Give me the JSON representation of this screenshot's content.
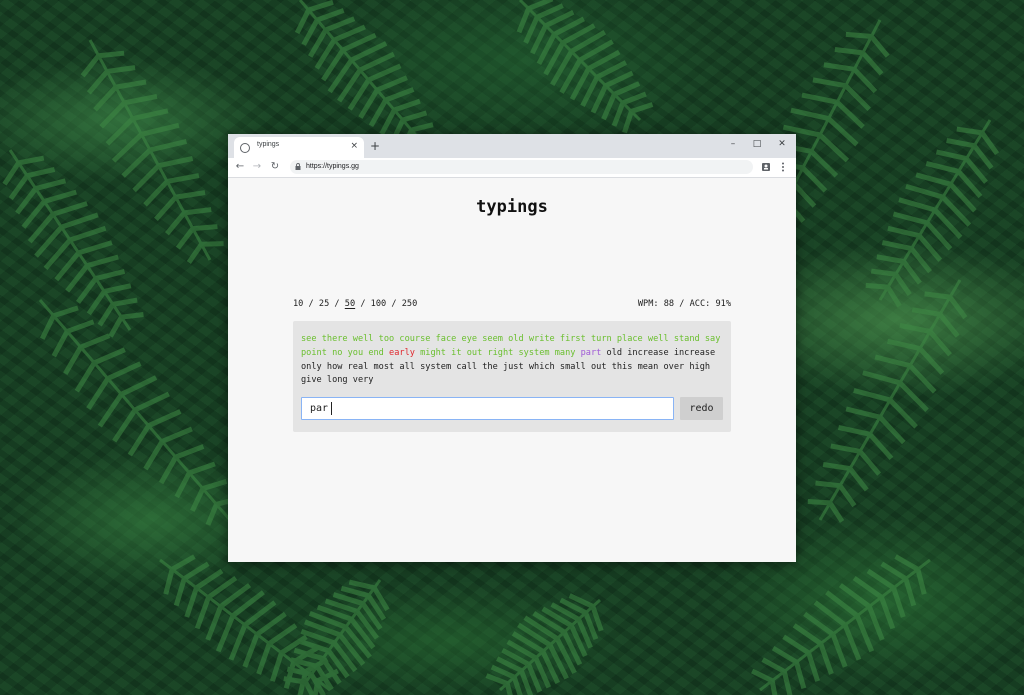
{
  "browser": {
    "tab_title": "typings",
    "tab_close": "×",
    "new_tab": "+",
    "window_controls": {
      "minimize": "–",
      "maximize": "□",
      "close": "✕"
    },
    "nav": {
      "back": "←",
      "forward": "→",
      "reload": "↻"
    },
    "url": "https://typings.gg"
  },
  "app": {
    "title": "typings",
    "word_count_options": [
      "10",
      "25",
      "50",
      "100",
      "250"
    ],
    "selected_word_count": "50",
    "separator": "/",
    "stats": "WPM: 88 / ACC: 91%",
    "prompt_words": [
      {
        "w": "see",
        "s": "correct"
      },
      {
        "w": "there",
        "s": "correct"
      },
      {
        "w": "well",
        "s": "correct"
      },
      {
        "w": "too",
        "s": "correct"
      },
      {
        "w": "course",
        "s": "correct"
      },
      {
        "w": "face",
        "s": "correct"
      },
      {
        "w": "eye",
        "s": "correct"
      },
      {
        "w": "seem",
        "s": "correct"
      },
      {
        "w": "old",
        "s": "correct"
      },
      {
        "w": "write",
        "s": "correct"
      },
      {
        "w": "first",
        "s": "correct"
      },
      {
        "w": "turn",
        "s": "correct"
      },
      {
        "w": "place",
        "s": "correct"
      },
      {
        "w": "well",
        "s": "correct"
      },
      {
        "w": "stand",
        "s": "correct"
      },
      {
        "w": "say",
        "s": "correct"
      },
      {
        "w": "point",
        "s": "correct"
      },
      {
        "w": "no",
        "s": "correct"
      },
      {
        "w": "you",
        "s": "correct"
      },
      {
        "w": "end",
        "s": "correct"
      },
      {
        "w": "early",
        "s": "wrong"
      },
      {
        "w": "might",
        "s": "correct"
      },
      {
        "w": "it",
        "s": "correct"
      },
      {
        "w": "out",
        "s": "correct"
      },
      {
        "w": "right",
        "s": "correct"
      },
      {
        "w": "system",
        "s": "correct"
      },
      {
        "w": "many",
        "s": "correct"
      },
      {
        "w": "part",
        "s": "current"
      },
      {
        "w": "old",
        "s": "pending"
      },
      {
        "w": "increase",
        "s": "pending"
      },
      {
        "w": "increase",
        "s": "pending"
      },
      {
        "w": "only",
        "s": "pending"
      },
      {
        "w": "how",
        "s": "pending"
      },
      {
        "w": "real",
        "s": "pending"
      },
      {
        "w": "most",
        "s": "pending"
      },
      {
        "w": "all",
        "s": "pending"
      },
      {
        "w": "system",
        "s": "pending"
      },
      {
        "w": "call",
        "s": "pending"
      },
      {
        "w": "the",
        "s": "pending"
      },
      {
        "w": "just",
        "s": "pending"
      },
      {
        "w": "which",
        "s": "pending"
      },
      {
        "w": "small",
        "s": "pending"
      },
      {
        "w": "out",
        "s": "pending"
      },
      {
        "w": "this",
        "s": "pending"
      },
      {
        "w": "mean",
        "s": "pending"
      },
      {
        "w": "over",
        "s": "pending"
      },
      {
        "w": "high",
        "s": "pending"
      },
      {
        "w": "give",
        "s": "pending"
      },
      {
        "w": "long",
        "s": "pending"
      },
      {
        "w": "very",
        "s": "pending"
      }
    ],
    "input_value": "par",
    "redo_label": "redo"
  },
  "colors": {
    "correct": "#6abf2e",
    "wrong": "#e0282e",
    "current": "#a05ad6",
    "input_focus_border": "#89b4f5"
  }
}
